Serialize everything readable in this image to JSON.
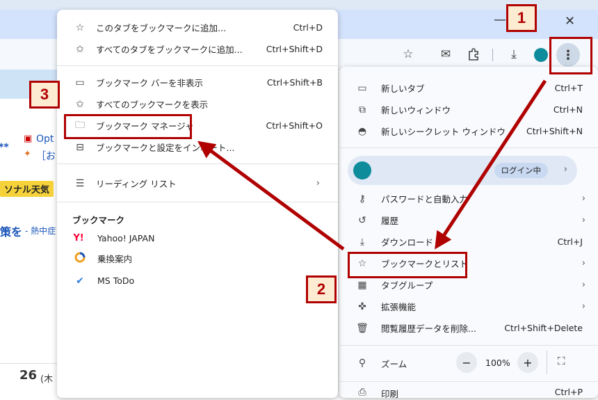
{
  "browser": {
    "close_glyph": "✕",
    "minimize_glyph": "—",
    "toolbar_icons": [
      "star-icon",
      "mail-icon",
      "extension-icon",
      "download-icon",
      "profile-avatar",
      "kebab-menu-icon"
    ]
  },
  "background": {
    "snippet1": "Opt",
    "snippet2": "［お",
    "snippet3": "**",
    "weather_label": "ソナル天気",
    "link_text": "策を",
    "link_suffix": "- 熱中症",
    "day": "26",
    "day_suffix": "(木"
  },
  "bookmark_submenu": {
    "items": [
      {
        "icon": "star-icon",
        "label": "このタブをブックマークに追加...",
        "shortcut": "Ctrl+D"
      },
      {
        "icon": "star-multi-icon",
        "label": "すべてのタブをブックマークに追加...",
        "shortcut": "Ctrl+Shift+D"
      },
      {
        "icon": "bookmark-bar-icon",
        "label": "ブックマーク バーを非表示",
        "shortcut": "Ctrl+Shift+B"
      },
      {
        "icon": "star-multi-icon",
        "label": "すべてのブックマークを表示",
        "shortcut": ""
      },
      {
        "icon": "folder-edit-icon",
        "label": "ブックマーク マネージャ",
        "shortcut": "Ctrl+Shift+O"
      },
      {
        "icon": "import-icon",
        "label": "ブックマークと設定をインポート...",
        "shortcut": ""
      },
      {
        "icon": "reading-list-icon",
        "label": "リーディング リスト",
        "shortcut": ""
      }
    ],
    "section_title": "ブックマーク",
    "bookmarks": [
      {
        "icon": "yahoo-icon",
        "label": "Yahoo! JAPAN"
      },
      {
        "icon": "transit-icon",
        "label": "乗換案内"
      },
      {
        "icon": "todo-icon",
        "label": "MS ToDo"
      }
    ]
  },
  "main_menu": {
    "top_items": [
      {
        "icon": "new-tab-icon",
        "label": "新しいタブ",
        "shortcut": "Ctrl+T"
      },
      {
        "icon": "new-window-icon",
        "label": "新しいウィンドウ",
        "shortcut": "Ctrl+N"
      },
      {
        "icon": "incognito-icon",
        "label": "新しいシークレット ウィンドウ",
        "shortcut": "Ctrl+Shift+N"
      }
    ],
    "profile": {
      "status": "ログイン中"
    },
    "mid_items": [
      {
        "icon": "key-icon",
        "label": "パスワードと自動入力",
        "shortcut": ""
      },
      {
        "icon": "history-icon",
        "label": "履歴",
        "shortcut": ""
      },
      {
        "icon": "download-icon",
        "label": "ダウンロード",
        "shortcut": "Ctrl+J"
      },
      {
        "icon": "star-icon",
        "label": "ブックマークとリスト",
        "shortcut": ""
      },
      {
        "icon": "tab-groups-icon",
        "label": "タブグループ",
        "shortcut": ""
      },
      {
        "icon": "extension-icon",
        "label": "拡張機能",
        "shortcut": ""
      },
      {
        "icon": "trash-icon",
        "label": "閲覧履歴データを削除...",
        "shortcut": "Ctrl+Shift+Delete"
      }
    ],
    "zoom": {
      "label": "ズーム",
      "minus": "−",
      "value": "100%",
      "plus": "+"
    },
    "print": {
      "label": "印刷",
      "shortcut": "Ctrl+P"
    }
  },
  "annotations": {
    "badge1": "1",
    "badge2": "2",
    "badge3": "3",
    "highlight_color": "#b00000"
  }
}
